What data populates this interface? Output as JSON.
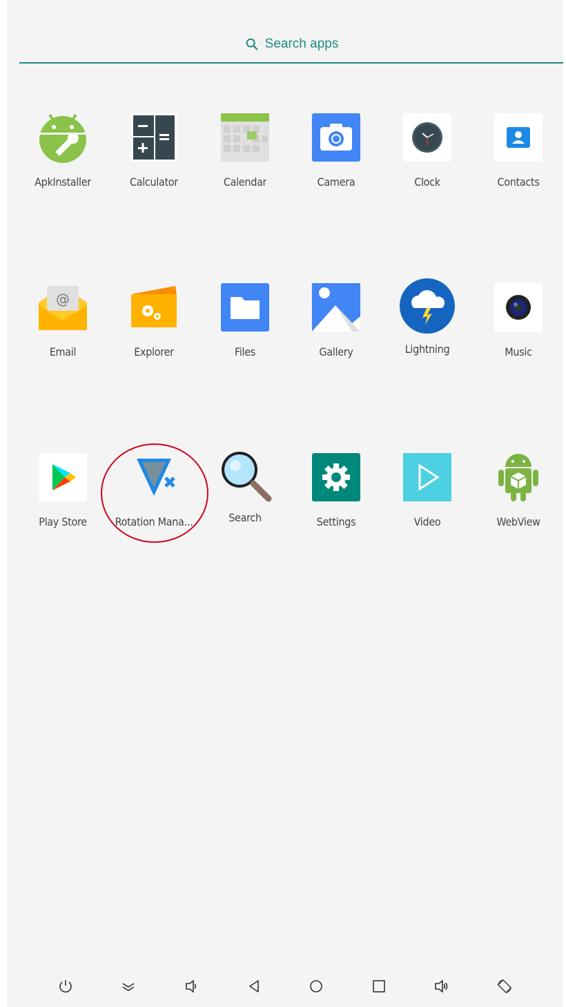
{
  "search": {
    "label": "Search apps"
  },
  "apps": [
    {
      "label": "ApkInstaller",
      "icon": "apk-installer-icon"
    },
    {
      "label": "Calculator",
      "icon": "calculator-icon"
    },
    {
      "label": "Calendar",
      "icon": "calendar-icon"
    },
    {
      "label": "Camera",
      "icon": "camera-icon"
    },
    {
      "label": "Clock",
      "icon": "clock-icon"
    },
    {
      "label": "Contacts",
      "icon": "contacts-icon"
    },
    {
      "label": "Email",
      "icon": "email-icon"
    },
    {
      "label": "Explorer",
      "icon": "explorer-icon"
    },
    {
      "label": "Files",
      "icon": "files-icon"
    },
    {
      "label": "Gallery",
      "icon": "gallery-icon"
    },
    {
      "label": "Lightning",
      "icon": "lightning-icon"
    },
    {
      "label": "Music",
      "icon": "music-icon"
    },
    {
      "label": "Play Store",
      "icon": "play-store-icon"
    },
    {
      "label": "Rotation Mana...",
      "icon": "rotation-manager-icon"
    },
    {
      "label": "Search",
      "icon": "search-magnifier-icon"
    },
    {
      "label": "Settings",
      "icon": "settings-icon"
    },
    {
      "label": "Video",
      "icon": "video-icon"
    },
    {
      "label": "WebView",
      "icon": "webview-icon"
    }
  ],
  "navbar": [
    "power-icon",
    "collapse-icon",
    "volume-down-icon",
    "back-icon",
    "home-icon",
    "recents-icon",
    "volume-up-icon",
    "rotate-icon"
  ],
  "colors": {
    "accent": "#1e8c80",
    "highlight": "#d0021b",
    "background": "#f4f4f4"
  }
}
